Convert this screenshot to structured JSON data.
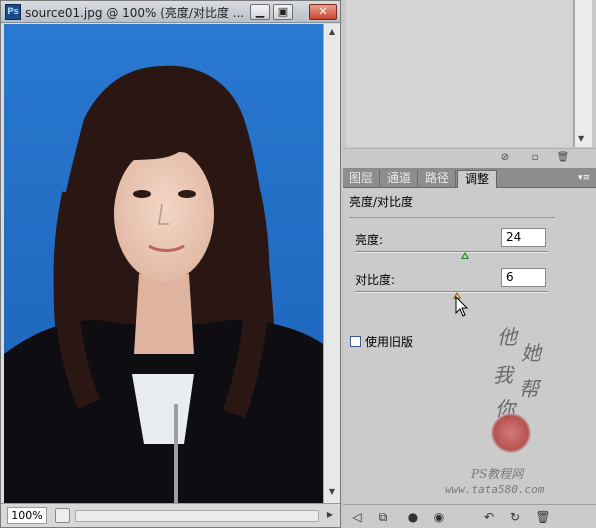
{
  "document": {
    "app_icon_text": "Ps",
    "title": "source01.jpg @ 100% (亮度/对比度 ...",
    "window_buttons": {
      "minimize": "minimize-icon",
      "restore": "restore-icon",
      "close": "close-icon"
    },
    "zoom": "100%",
    "colors": {
      "background": "#1f6fc8"
    }
  },
  "panel": {
    "tabs": [
      {
        "label": "图层",
        "active": false
      },
      {
        "label": "通道",
        "active": false
      },
      {
        "label": "路径",
        "active": false
      },
      {
        "label": "调整",
        "active": true
      }
    ],
    "heading": "亮度/对比度",
    "brightness": {
      "label": "亮度:",
      "value": "24",
      "level": 0.57
    },
    "contrast": {
      "label": "对比度:",
      "value": "6",
      "level": 0.53
    },
    "legacy_label": "使用旧版",
    "legacy_checked": false
  },
  "watermark": {
    "calligraphy": "他她我帮你",
    "ps_label": "PS教程网",
    "site": "www.tata580.com"
  }
}
